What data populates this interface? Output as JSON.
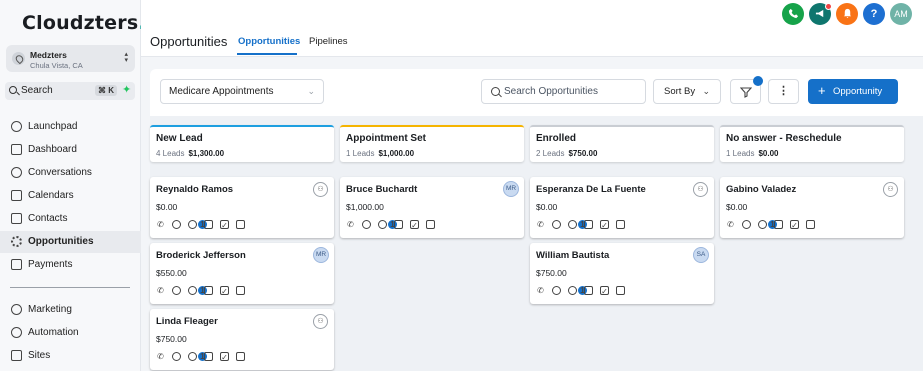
{
  "app": {
    "logo_text": "Cloudzters",
    "logo_dot": ".",
    "location_name": "Medzters",
    "location_city": "Chula Vista, CA",
    "search_label": "Search",
    "search_shortcut": "⌘ K"
  },
  "sidebar": {
    "items": [
      {
        "label": "Launchpad",
        "icon": "rocket-icon"
      },
      {
        "label": "Dashboard",
        "icon": "grid-icon"
      },
      {
        "label": "Conversations",
        "icon": "chat-icon"
      },
      {
        "label": "Calendars",
        "icon": "calendar-icon"
      },
      {
        "label": "Contacts",
        "icon": "contacts-icon"
      },
      {
        "label": "Opportunities",
        "icon": "opportunities-icon",
        "active": true
      },
      {
        "label": "Payments",
        "icon": "payments-icon"
      },
      {
        "label": "Marketing",
        "icon": "send-icon"
      },
      {
        "label": "Automation",
        "icon": "automation-icon"
      },
      {
        "label": "Sites",
        "icon": "sites-icon"
      }
    ]
  },
  "header": {
    "title": "Opportunities",
    "tabs": [
      {
        "label": "Opportunities",
        "active": true
      },
      {
        "label": "Pipelines",
        "active": false
      }
    ],
    "user_initials": "AM",
    "help_label": "?",
    "colors": {
      "phone": "#16a34a",
      "announce": "#0f766e",
      "notify": "#f97316",
      "help": "#1d6fd1",
      "avatar": "#6fb3a7"
    }
  },
  "toolbar": {
    "pipeline_value": "Medicare Appointments",
    "search_placeholder": "Search Opportunities",
    "sort_label": "Sort By",
    "more_label": "⋮",
    "add_label": "Opportunity",
    "add_plus": "+"
  },
  "columns": [
    {
      "title": "New Lead",
      "count": "4 Leads",
      "amount": "$1,300.00",
      "cards": [
        {
          "name": "Reynaldo Ramos",
          "value": "$0.00",
          "owner": "",
          "badge": "1"
        },
        {
          "name": "Broderick Jefferson",
          "value": "$550.00",
          "owner": "MR",
          "badge": "1"
        },
        {
          "name": "Linda Fleager",
          "value": "$750.00",
          "owner": "",
          "badge": "1"
        }
      ]
    },
    {
      "title": "Appointment Set",
      "count": "1 Leads",
      "amount": "$1,000.00",
      "cards": [
        {
          "name": "Bruce Buchardt",
          "value": "$1,000.00",
          "owner": "MR",
          "badge": "1"
        }
      ]
    },
    {
      "title": "Enrolled",
      "count": "2 Leads",
      "amount": "$750.00",
      "cards": [
        {
          "name": "Esperanza De La Fuente",
          "value": "$0.00",
          "owner": "",
          "badge": "1"
        },
        {
          "name": "William Bautista",
          "value": "$750.00",
          "owner": "SA",
          "badge": "1"
        }
      ]
    },
    {
      "title": "No answer - Reschedule",
      "count": "1 Leads",
      "amount": "$0.00",
      "cards": [
        {
          "name": "Gabino Valadez",
          "value": "$0.00",
          "owner": "",
          "badge": "1"
        }
      ]
    }
  ],
  "colors": {
    "accent": "#1570c9",
    "column_top": "#1e9fe0"
  }
}
